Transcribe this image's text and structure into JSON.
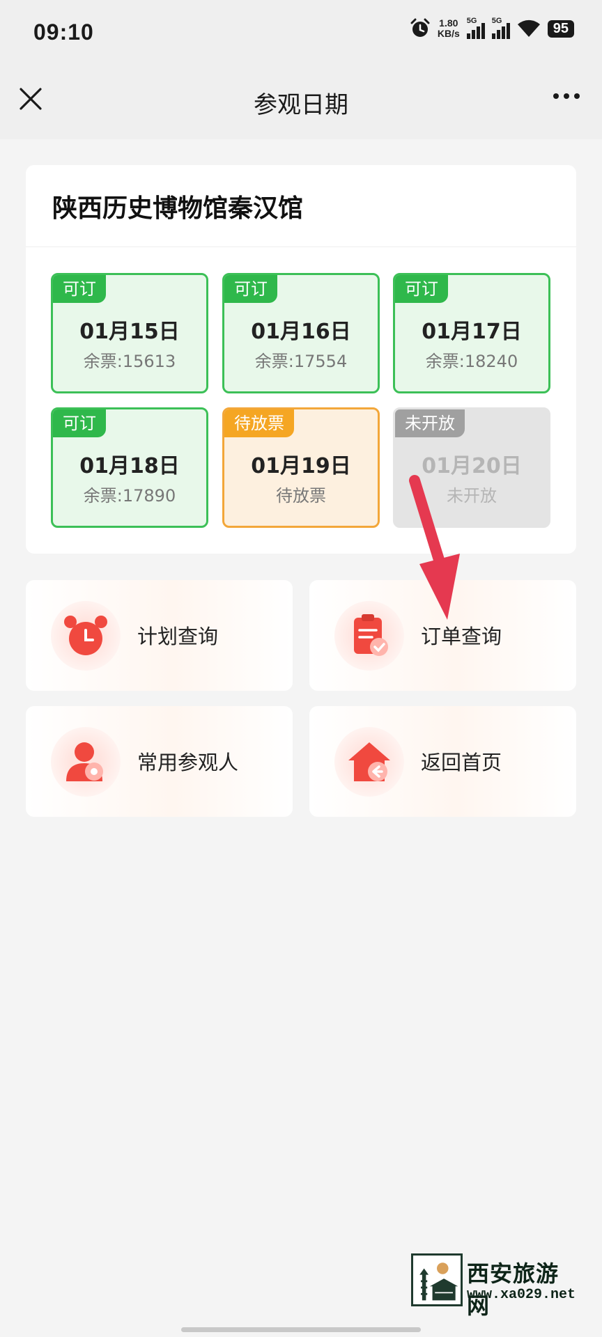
{
  "status_bar": {
    "time": "09:10",
    "net_speed_value": "1.80",
    "net_speed_unit": "KB/s",
    "signal_1_label": "5G",
    "signal_2_label": "5G",
    "battery": "95",
    "icons": [
      "alarm-icon",
      "signal-icon",
      "signal-icon",
      "wifi-icon",
      "battery-icon"
    ]
  },
  "nav": {
    "title": "参观日期",
    "close_icon": "close-icon",
    "more_icon": "more-icon"
  },
  "museum": {
    "name": "陕西历史博物馆秦汉馆"
  },
  "dates": [
    {
      "badge": "可订",
      "date": "01月15日",
      "remain": "余票:15613",
      "status": "available"
    },
    {
      "badge": "可订",
      "date": "01月16日",
      "remain": "余票:17554",
      "status": "available"
    },
    {
      "badge": "可订",
      "date": "01月17日",
      "remain": "余票:18240",
      "status": "available"
    },
    {
      "badge": "可订",
      "date": "01月18日",
      "remain": "余票:17890",
      "status": "available"
    },
    {
      "badge": "待放票",
      "date": "01月19日",
      "remain": "待放票",
      "status": "pending"
    },
    {
      "badge": "未开放",
      "date": "01月20日",
      "remain": "未开放",
      "status": "closed"
    }
  ],
  "actions": [
    {
      "label": "计划查询",
      "icon": "alarm-clock-icon"
    },
    {
      "label": "订单查询",
      "icon": "clipboard-check-icon"
    },
    {
      "label": "常用参观人",
      "icon": "visitor-icon"
    },
    {
      "label": "返回首页",
      "icon": "home-return-icon"
    }
  ],
  "colors": {
    "available": "#2fb84b",
    "pending": "#f5a623",
    "closed": "#a0a0a0",
    "icon_red": "#f0493f",
    "arrow": "#e53950"
  },
  "watermark": {
    "title": "西安旅游网",
    "url": "www.xa029.net"
  }
}
